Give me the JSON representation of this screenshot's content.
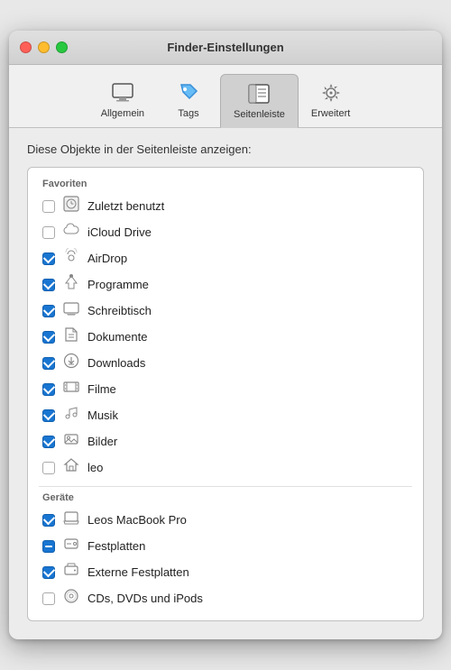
{
  "window": {
    "title": "Finder-Einstellungen"
  },
  "toolbar": {
    "items": [
      {
        "id": "allgemein",
        "label": "Allgemein",
        "icon": "🖥",
        "active": false
      },
      {
        "id": "tags",
        "label": "Tags",
        "icon": "🏷",
        "active": false
      },
      {
        "id": "seitenleiste",
        "label": "Seitenleiste",
        "icon": "📋",
        "active": true
      },
      {
        "id": "erweitert",
        "label": "Erweitert",
        "icon": "⚙️",
        "active": false
      }
    ]
  },
  "section": {
    "title": "Diese Objekte in der Seitenleiste anzeigen:"
  },
  "groups": [
    {
      "label": "Favoriten",
      "items": [
        {
          "id": "zuletzt",
          "label": "Zuletzt benutzt",
          "checked": false,
          "partial": false
        },
        {
          "id": "icloud",
          "label": "iCloud Drive",
          "checked": false,
          "partial": false
        },
        {
          "id": "airdrop",
          "label": "AirDrop",
          "checked": true,
          "partial": false
        },
        {
          "id": "programme",
          "label": "Programme",
          "checked": true,
          "partial": false
        },
        {
          "id": "schreibtisch",
          "label": "Schreibtisch",
          "checked": true,
          "partial": false
        },
        {
          "id": "dokumente",
          "label": "Dokumente",
          "checked": true,
          "partial": false
        },
        {
          "id": "downloads",
          "label": "Downloads",
          "checked": true,
          "partial": false
        },
        {
          "id": "filme",
          "label": "Filme",
          "checked": true,
          "partial": false
        },
        {
          "id": "musik",
          "label": "Musik",
          "checked": true,
          "partial": false
        },
        {
          "id": "bilder",
          "label": "Bilder",
          "checked": true,
          "partial": false
        },
        {
          "id": "leo",
          "label": "leo",
          "checked": false,
          "partial": false
        }
      ]
    },
    {
      "label": "Geräte",
      "items": [
        {
          "id": "macbook",
          "label": "Leos MacBook Pro",
          "checked": true,
          "partial": false
        },
        {
          "id": "festplatten",
          "label": "Festplatten",
          "checked": false,
          "partial": true
        },
        {
          "id": "ext-festplatten",
          "label": "Externe Festplatten",
          "checked": true,
          "partial": false
        },
        {
          "id": "cds",
          "label": "CDs, DVDs und iPods",
          "checked": false,
          "partial": false
        }
      ]
    }
  ],
  "icons": {
    "zuletzt": "🕐",
    "icloud": "☁",
    "airdrop": "📡",
    "programme": "🚀",
    "schreibtisch": "🖥",
    "dokumente": "📄",
    "downloads": "⬇",
    "filme": "🎞",
    "musik": "🎵",
    "bilder": "📷",
    "leo": "🏠",
    "macbook": "💻",
    "festplatten": "💿",
    "ext-festplatten": "🖥",
    "cds": "💿"
  }
}
